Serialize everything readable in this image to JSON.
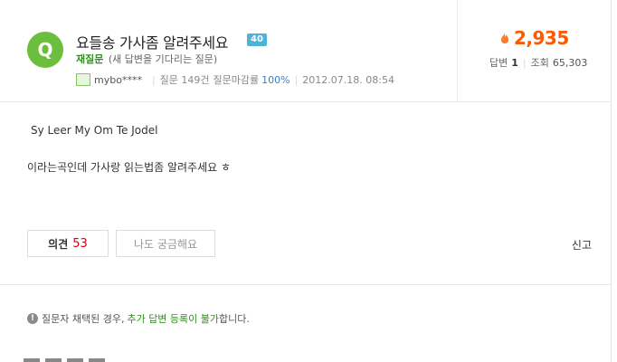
{
  "question": {
    "badge_letter": "Q",
    "title": "요들송 가사좀 알려주세요",
    "points": "40",
    "reask_label": "재질문",
    "reask_note": "(새 답변을 기다리는 질문)",
    "username": "mybo****",
    "question_count": "질문 149건",
    "close_rate_label": "질문마감률",
    "close_rate_value": "100%",
    "date": "2012.07.18.  08:54",
    "body_line1": "Sy Leer My Om Te Jodel",
    "body_line2": "이라는곡인데 가사랑 읽는법좀 알려주세요 ㅎ"
  },
  "stats": {
    "total": "2,935",
    "answers_label": "답변",
    "answers_value": "1",
    "views_label": "조회",
    "views_value": "65,303"
  },
  "actions": {
    "opinion_label": "의견",
    "opinion_count": "53",
    "curious_label": "나도 궁금해요",
    "report_label": "신고"
  },
  "notice": {
    "icon": "!",
    "pre": "질문자 채택된 경우,",
    "highlight": "추가 답변 등록이 불가",
    "post": "합니다."
  },
  "icons": {
    "question_badge": "q-badge-icon",
    "fire": "fire-icon",
    "info": "info-icon"
  },
  "colors": {
    "accent_green": "#6cbf3c",
    "total_orange": "#ff5a00",
    "points_blue": "#4fb3d6",
    "opinion_red": "#d0021b"
  }
}
